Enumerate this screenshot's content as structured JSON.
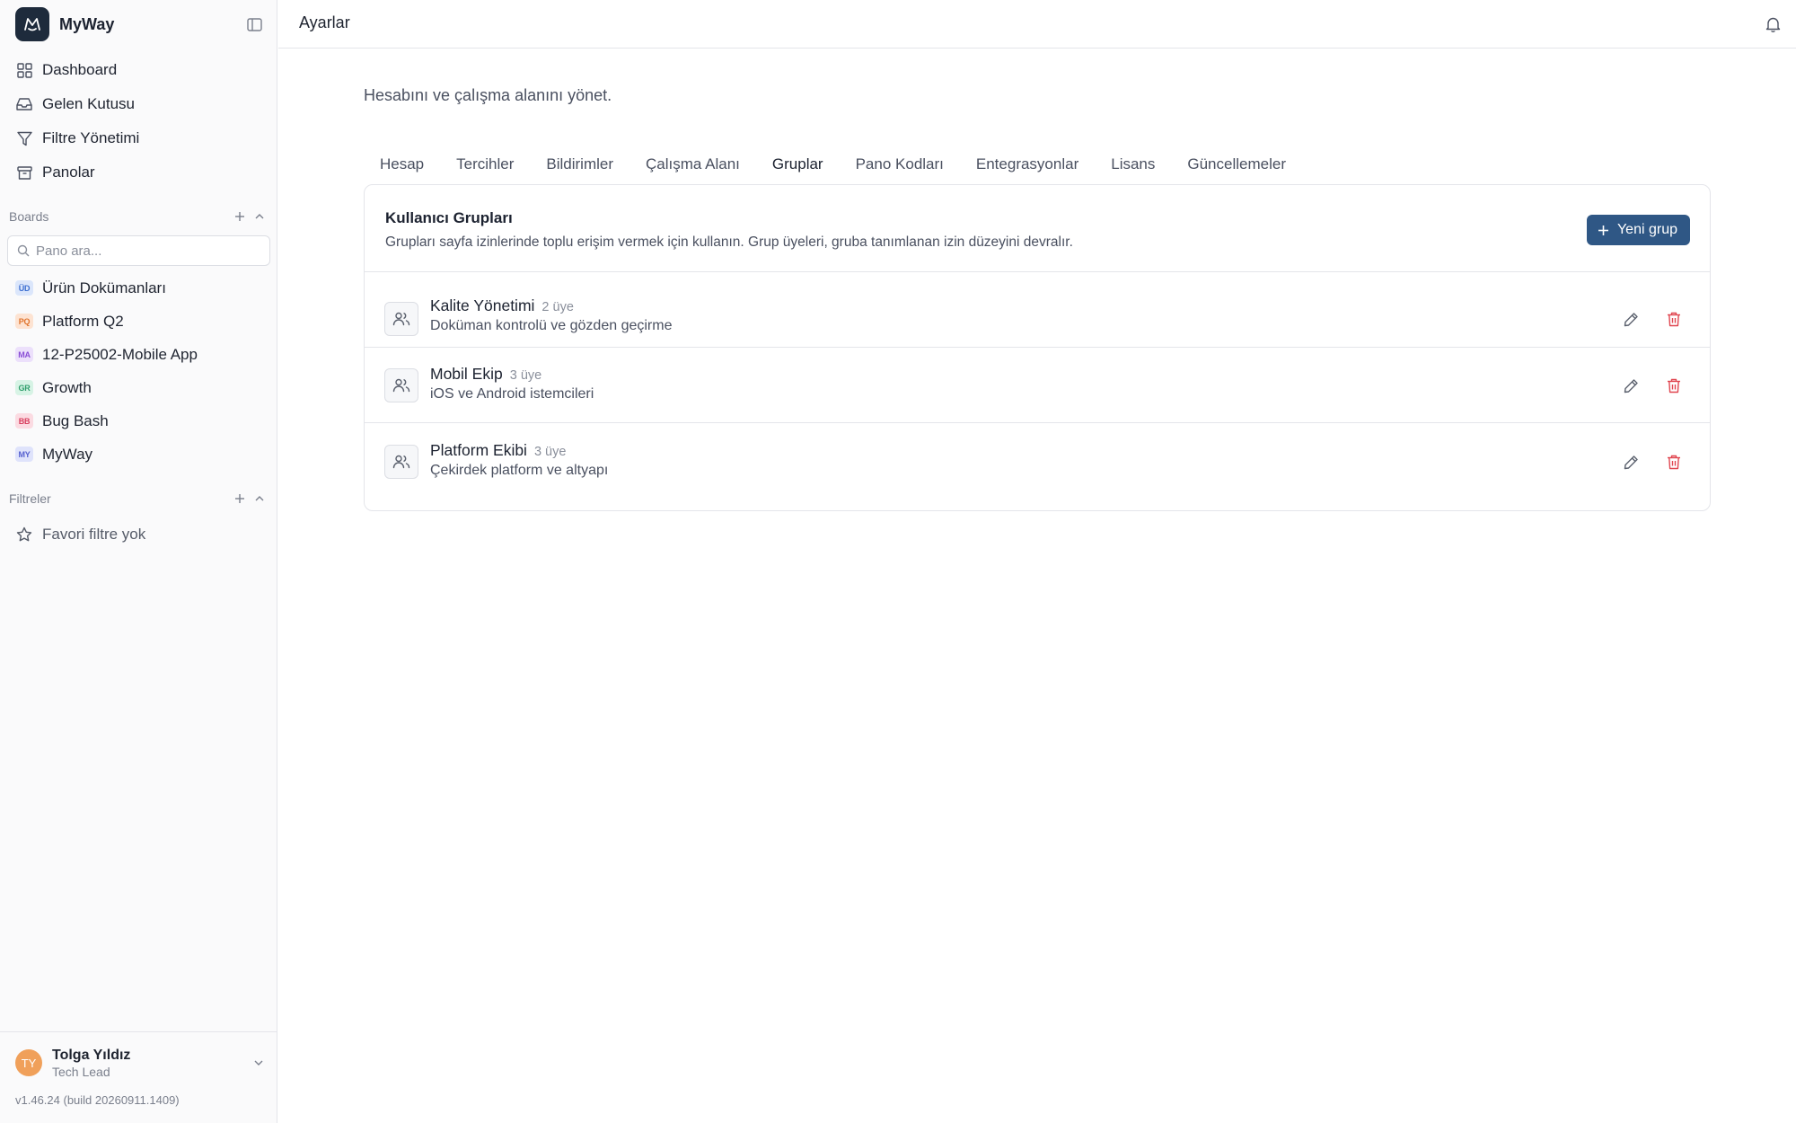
{
  "app": {
    "name": "MyWay"
  },
  "sidebar": {
    "nav": [
      {
        "label": "Dashboard",
        "icon": "dashboard-icon"
      },
      {
        "label": "Gelen Kutusu",
        "icon": "inbox-icon"
      },
      {
        "label": "Filtre Yönetimi",
        "icon": "filter-icon"
      },
      {
        "label": "Panolar",
        "icon": "archive-icon"
      }
    ],
    "boards_heading": "Boards",
    "board_search_placeholder": "Pano ara...",
    "boards": [
      {
        "label": "Ürün Dokümanları",
        "abbr": "ÜD",
        "bg": "#dbe6fb",
        "fg": "#3d6fd1"
      },
      {
        "label": "Platform Q2",
        "abbr": "PQ",
        "bg": "#fde3d2",
        "fg": "#e0742e"
      },
      {
        "label": "12-P25002-Mobile App",
        "abbr": "MA",
        "bg": "#ece0fb",
        "fg": "#8a4fd6"
      },
      {
        "label": "Growth",
        "abbr": "GR",
        "bg": "#d7f3e5",
        "fg": "#2f9e6b"
      },
      {
        "label": "Bug Bash",
        "abbr": "BB",
        "bg": "#fbdbe2",
        "fg": "#d8405f"
      },
      {
        "label": "MyWay",
        "abbr": "MY",
        "bg": "#dfe3fb",
        "fg": "#5560cf"
      }
    ],
    "filters_heading": "Filtreler",
    "favorites_empty": "Favori filtre yok",
    "user": {
      "initials": "TY",
      "name": "Tolga Yıldız",
      "role": "Tech Lead"
    },
    "version": "v1.46.24 (build 20260911.1409)"
  },
  "topbar": {
    "title": "Ayarlar"
  },
  "main": {
    "subtitle": "Hesabını ve çalışma alanını yönet.",
    "tabs": [
      {
        "label": "Hesap"
      },
      {
        "label": "Tercihler"
      },
      {
        "label": "Bildirimler"
      },
      {
        "label": "Çalışma Alanı"
      },
      {
        "label": "Gruplar"
      },
      {
        "label": "Pano Kodları"
      },
      {
        "label": "Entegrasyonlar"
      },
      {
        "label": "Lisans"
      },
      {
        "label": "Güncellemeler"
      }
    ],
    "active_tab": "Gruplar",
    "card": {
      "title": "Kullanıcı Grupları",
      "description": "Grupları sayfa izinlerinde toplu erişim vermek için kullanın. Grup üyeleri, gruba tanımlanan izin düzeyini devralır.",
      "new_button": "Yeni grup",
      "groups": [
        {
          "name": "Kalite Yönetimi",
          "count": "2 üye",
          "description": "Doküman kontrolü ve gözden geçirme"
        },
        {
          "name": "Mobil Ekip",
          "count": "3 üye",
          "description": "iOS ve Android istemcileri"
        },
        {
          "name": "Platform Ekibi",
          "count": "3 üye",
          "description": "Çekirdek platform ve altyapı"
        }
      ]
    }
  },
  "colors": {
    "accent": "#2f5785",
    "danger": "#e0454f",
    "avatar": "#f0a05a"
  }
}
